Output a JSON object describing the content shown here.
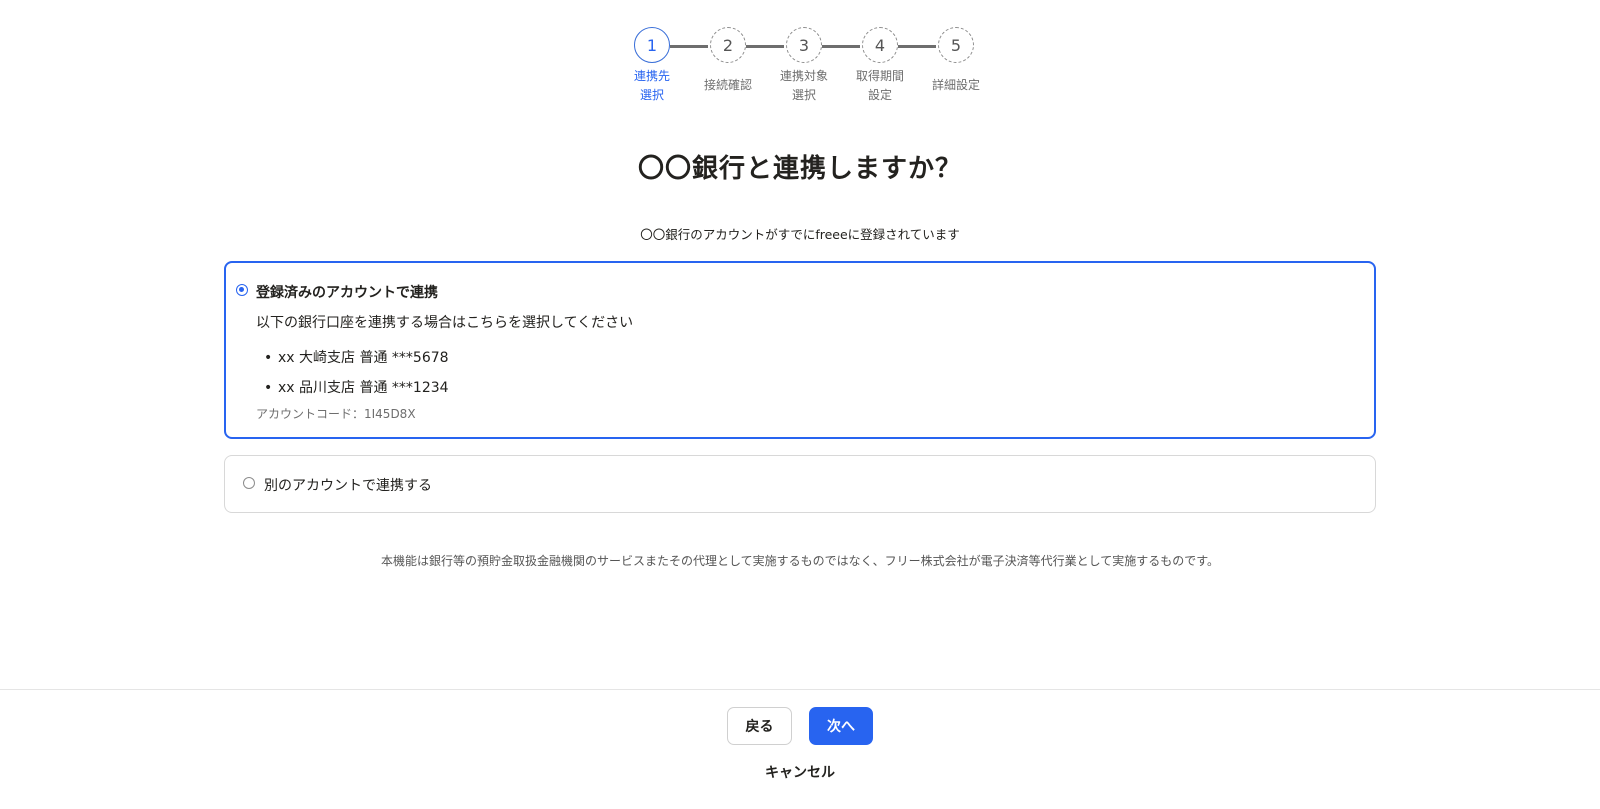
{
  "stepper": {
    "steps": [
      {
        "number": "1",
        "label": "連携先\n選択",
        "state": "active"
      },
      {
        "number": "2",
        "label": "接続確認",
        "state": "pending"
      },
      {
        "number": "3",
        "label": "連携対象\n選択",
        "state": "pending"
      },
      {
        "number": "4",
        "label": "取得期間\n設定",
        "state": "pending"
      },
      {
        "number": "5",
        "label": "詳細設定",
        "state": "pending"
      }
    ]
  },
  "main": {
    "title": "〇〇銀行と連携しますか？",
    "subtitle": "〇〇銀行のアカウントがすでにfreeeに登録されています",
    "options": [
      {
        "label": "登録済みのアカウントで連携",
        "selected": true,
        "description": "以下の銀行口座を連携する場合はこちらを選択してください",
        "accounts": [
          "xx 大崎支店 普通 ***5678",
          "xx 品川支店 普通 ***1234"
        ],
        "account_code": "アカウントコード：1I45D8X"
      },
      {
        "label": "別のアカウントで連携する",
        "selected": false
      }
    ],
    "disclaimer": "本機能は銀行等の預貯金取扱金融機関のサービスまたその代理として実施するものではなく、フリー株式会社が電子決済等代行業として実施するものです。"
  },
  "footer": {
    "back_label": "戻る",
    "next_label": "次へ",
    "cancel_label": "キャンセル"
  },
  "colors": {
    "accent": "#2864f0",
    "text": "#23221f",
    "muted": "#6e6e6e",
    "border": "#d8d8d8"
  }
}
